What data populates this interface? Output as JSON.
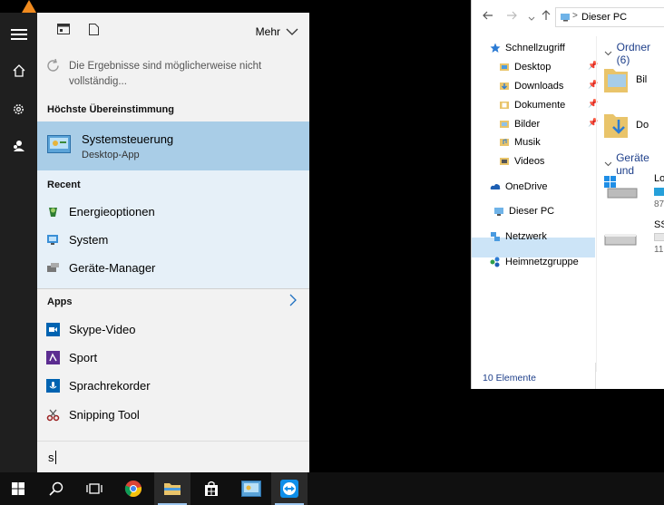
{
  "start_rail": {
    "items": [
      "hamburger-icon",
      "home-icon",
      "settings-icon",
      "user-icon"
    ]
  },
  "search_panel": {
    "more_label": "Mehr",
    "notice": "Die Ergebnisse sind möglicherweise nicht vollständig...",
    "best_match_header": "Höchste Übereinstimmung",
    "best_match": {
      "title": "Systemsteuerung",
      "subtitle": "Desktop-App"
    },
    "recent_header": "Recent",
    "recent": [
      {
        "label": "Energieoptionen",
        "icon": "power-options-icon"
      },
      {
        "label": "System",
        "icon": "system-icon"
      },
      {
        "label": "Geräte-Manager",
        "icon": "device-manager-icon"
      }
    ],
    "apps_header": "Apps",
    "apps": [
      {
        "label": "Skype-Video",
        "icon": "skype-video-icon",
        "color": "#0063b1"
      },
      {
        "label": "Sport",
        "icon": "sport-icon",
        "color": "#5c2d91"
      },
      {
        "label": "Sprachrekorder",
        "icon": "voice-recorder-icon",
        "color": "#0063b1"
      },
      {
        "label": "Snipping Tool",
        "icon": "snipping-tool-icon",
        "color": "#9a1f1f"
      }
    ],
    "search_value": "s"
  },
  "taskbar": {
    "items": [
      "windows-start-icon",
      "search-icon",
      "task-view-icon",
      "chrome-icon",
      "file-explorer-icon",
      "store-icon",
      "control-panel-icon",
      "teamviewer-icon"
    ],
    "active_color": "#9ec7ef"
  },
  "explorer": {
    "address": "Dieser PC",
    "nav": {
      "quick_access": "Schnellzugriff",
      "desktop": "Desktop",
      "downloads": "Downloads",
      "documents": "Dokumente",
      "pictures": "Bilder",
      "music": "Musik",
      "videos": "Videos",
      "onedrive": "OneDrive",
      "this_pc": "Dieser PC",
      "network": "Netzwerk",
      "homegroup": "Heimnetzgruppe"
    },
    "content": {
      "folders_group": "Ordner (6)",
      "folder1": "Bil",
      "folder2": "Do",
      "devices_group": "Geräte und",
      "drive1_name": "Lo",
      "drive1_free": "87",
      "drive2_name": "SS",
      "drive2_free": "11"
    },
    "status": "10 Elemente"
  }
}
